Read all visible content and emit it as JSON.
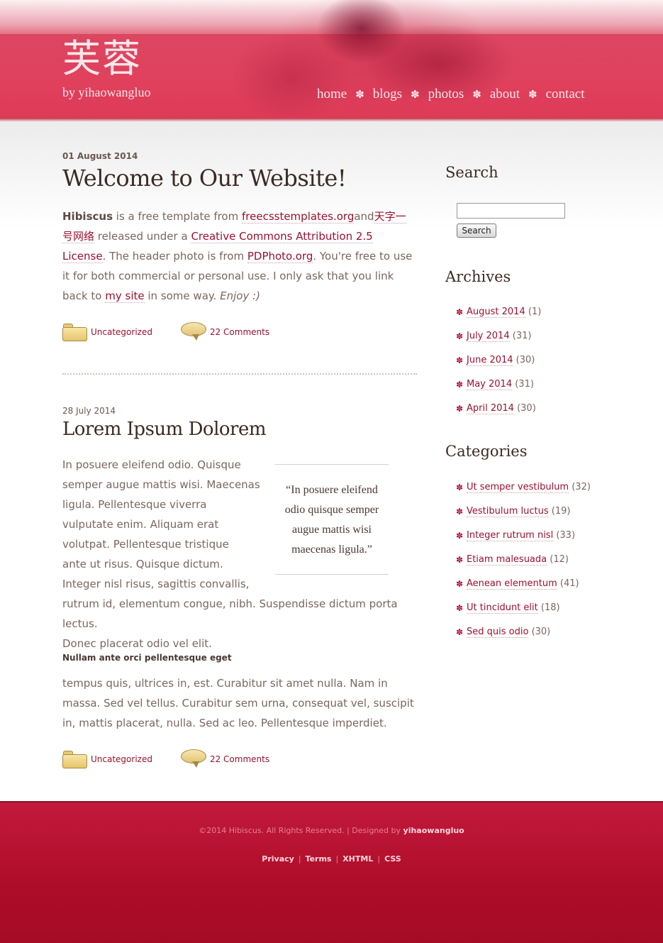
{
  "header": {
    "logo": "芙蓉",
    "tagline": "by yihaowangluo",
    "nav": [
      "home",
      "blogs",
      "photos",
      "about",
      "contact"
    ],
    "nav_separator": "✽"
  },
  "posts": [
    {
      "date": "01 August 2014",
      "title": "Welcome to Our Website!",
      "body": {
        "strong": "Hibiscus",
        "t1": " is a free template from ",
        "link1": "freecsstemplates.org",
        "t2": "and",
        "link2": "天字一号网络",
        "t3": " released under a ",
        "link3": "Creative Commons Attribution 2.5 License",
        "t4": ". The header photo is from ",
        "link4": "PDPhoto.org",
        "t5": ". You're free to use it for both commercial or personal use. I only ask that you link back to ",
        "link5": "my site",
        "t6": " in some way. ",
        "em": "Enjoy :)"
      },
      "category": "Uncategorized",
      "comments": "22 Comments"
    },
    {
      "date": "28 July 2014",
      "title": "Lorem Ipsum Dolorem",
      "para1_lines": [
        "In posuere eleifend odio. Quisque",
        "semper augue mattis wisi. Maecenas",
        "ligula. Pellentesque viverra",
        "vulputate enim. Aliquam erat",
        "volutpat. Pellentesque tristique",
        "ante ut risus. Quisque dictum.",
        "Integer nisl risus, sagittis convallis,",
        "rutrum id, elementum congue, nibh. Suspendisse dictum porta lectus.",
        "Donec placerat odio vel elit."
      ],
      "pullquote_lines": [
        "“In posuere eleifend",
        "odio quisque semper",
        "augue mattis wisi",
        "maecenas ligula.”"
      ],
      "subhead": "Nullam ante orci pellentesque eget",
      "para2": "tempus quis, ultrices in, est. Curabitur sit amet nulla. Nam in massa. Sed vel tellus. Curabitur sem urna, consequat vel, suscipit in, mattis placerat, nulla. Sed ac leo. Pellentesque imperdiet.",
      "category": "Uncategorized",
      "comments": "22 Comments"
    }
  ],
  "sidebar": {
    "search_title": "Search",
    "search_input_value": "",
    "search_button": "Search",
    "archives_title": "Archives",
    "archives": [
      {
        "label": "August 2014",
        "count": "(1)"
      },
      {
        "label": "July 2014",
        "count": "(31)"
      },
      {
        "label": "June 2014",
        "count": "(30)"
      },
      {
        "label": "May 2014",
        "count": "(31)"
      },
      {
        "label": "April 2014",
        "count": "(30)"
      }
    ],
    "categories_title": "Categories",
    "categories": [
      {
        "label": "Ut semper vestibulum",
        "count": "(32)"
      },
      {
        "label": "Vestibulum luctus",
        "count": "(19)"
      },
      {
        "label": "Integer rutrum nisl",
        "count": "(33)"
      },
      {
        "label": "Etiam malesuada",
        "count": "(12)"
      },
      {
        "label": "Aenean elementum",
        "count": "(41)"
      },
      {
        "label": "Ut tincidunt elit",
        "count": "(18)"
      },
      {
        "label": "Sed quis odio",
        "count": "(30)"
      }
    ],
    "bullet": "✽"
  },
  "footer": {
    "copyright": "©2014 Hibiscus. All Rights Reserved. | Designed by ",
    "designer": "yihaowangluo",
    "links": [
      "Privacy",
      "Terms",
      "XHTML",
      "CSS"
    ],
    "separator": "|"
  },
  "colors": {
    "header_red": "#dc4660",
    "link": "#9b1030",
    "footer_red": "#ad0d28"
  }
}
